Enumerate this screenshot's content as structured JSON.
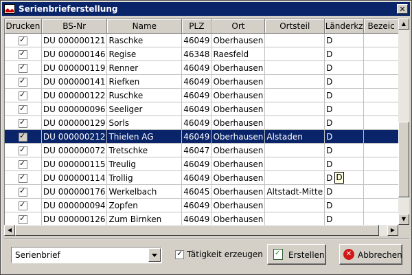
{
  "window": {
    "title": "Serienbrieferstellung",
    "close_glyph": "✕",
    "icon": "chart-icon"
  },
  "columns": [
    "Drucken",
    "BS-Nr",
    "Name",
    "PLZ",
    "Ort",
    "Ortsteil",
    "Länderkz",
    "Bezeic"
  ],
  "rows": [
    {
      "checked": true,
      "bsnr": "DU 000000121",
      "name": "Raschke",
      "plz": "46049",
      "ort": "Oberhausen",
      "ortsteil": "",
      "laenderkz": "D",
      "selected": false
    },
    {
      "checked": true,
      "bsnr": "DU 000000146",
      "name": "Regise",
      "plz": "46348",
      "ort": "Raesfeld",
      "ortsteil": "",
      "laenderkz": "D",
      "selected": false
    },
    {
      "checked": true,
      "bsnr": "DU 000000119",
      "name": "Renner",
      "plz": "46049",
      "ort": "Oberhausen",
      "ortsteil": "",
      "laenderkz": "D",
      "selected": false
    },
    {
      "checked": true,
      "bsnr": "DU 000000141",
      "name": "Riefken",
      "plz": "46049",
      "ort": "Oberhausen",
      "ortsteil": "",
      "laenderkz": "D",
      "selected": false
    },
    {
      "checked": true,
      "bsnr": "DU 000000122",
      "name": "Ruschke",
      "plz": "46049",
      "ort": "Oberhausen",
      "ortsteil": "",
      "laenderkz": "D",
      "selected": false
    },
    {
      "checked": true,
      "bsnr": "DU 000000096",
      "name": "Seeliger",
      "plz": "46049",
      "ort": "Oberhausen",
      "ortsteil": "",
      "laenderkz": "D",
      "selected": false
    },
    {
      "checked": true,
      "bsnr": "DU 000000129",
      "name": "Sorls",
      "plz": "46049",
      "ort": "Oberhausen",
      "ortsteil": "",
      "laenderkz": "D",
      "selected": false
    },
    {
      "checked": true,
      "bsnr": "DU 000000212",
      "name": "Thielen AG",
      "plz": "46049",
      "ort": "Oberhausen",
      "ortsteil": "Alstaden",
      "laenderkz": "D",
      "selected": true
    },
    {
      "checked": true,
      "bsnr": "DU 000000072",
      "name": "Tretschke",
      "plz": "46047",
      "ort": "Oberhausen",
      "ortsteil": "",
      "laenderkz": "D",
      "selected": false
    },
    {
      "checked": true,
      "bsnr": "DU 000000115",
      "name": "Treulig",
      "plz": "46049",
      "ort": "Oberhausen",
      "ortsteil": "",
      "laenderkz": "D",
      "selected": false
    },
    {
      "checked": true,
      "bsnr": "DU 000000114",
      "name": "Trollig",
      "plz": "46049",
      "ort": "Oberhausen",
      "ortsteil": "",
      "laenderkz": "D",
      "selected": false
    },
    {
      "checked": true,
      "bsnr": "DU 000000176",
      "name": "Werkelbach",
      "plz": "46045",
      "ort": "Oberhausen",
      "ortsteil": "Altstadt-Mitte",
      "laenderkz": "D",
      "selected": false
    },
    {
      "checked": true,
      "bsnr": "DU 000000094",
      "name": "Zopfen",
      "plz": "46049",
      "ort": "Oberhausen",
      "ortsteil": "",
      "laenderkz": "D",
      "selected": false
    },
    {
      "checked": true,
      "bsnr": "DU 000000126",
      "name": "Zum Birnken",
      "plz": "46049",
      "ort": "Oberhausen",
      "ortsteil": "",
      "laenderkz": "D",
      "selected": false
    }
  ],
  "tooltip": "D",
  "footer": {
    "template_select": "Serienbrief",
    "activity_checkbox": {
      "label": "Tätigkeit erzeugen",
      "checked": true
    },
    "create_button": "Erstellen",
    "cancel_button": "Abbrechen"
  },
  "scroll": {
    "up": "▲",
    "down": "▼",
    "left": "◀",
    "right": "▶",
    "vertical_position": 0.85,
    "horizontal_position": 0.0
  },
  "colors": {
    "titlebar": "#0a246a",
    "selection": "#0a246a",
    "face": "#d4d0c8"
  }
}
